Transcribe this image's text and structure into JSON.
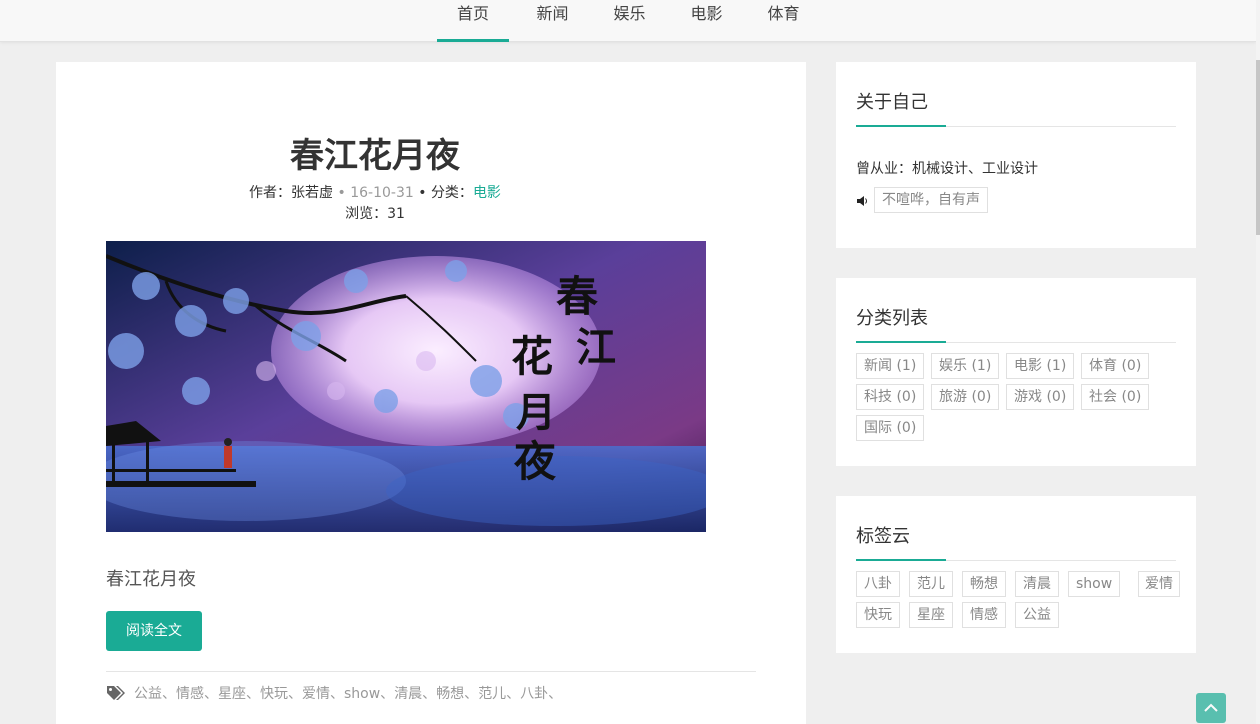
{
  "nav": {
    "items": [
      {
        "label": "首页",
        "active": true
      },
      {
        "label": "新闻",
        "active": false
      },
      {
        "label": "娱乐",
        "active": false
      },
      {
        "label": "电影",
        "active": false
      },
      {
        "label": "体育",
        "active": false
      }
    ]
  },
  "post": {
    "title": "春江花月夜",
    "author_label": "作者：",
    "author": "张若虚",
    "date": "16-10-31",
    "category_label": "分类：",
    "category": "电影",
    "views_label": "浏览：",
    "views": "31",
    "excerpt": "春江花月夜",
    "read_more": "阅读全文",
    "banner_text": [
      "春",
      "江",
      "花",
      "月",
      "夜"
    ],
    "tags": [
      "公益、",
      "情感、",
      "星座、",
      "快玩、",
      "爱情、",
      "show、",
      "清晨、",
      "畅想、",
      "范儿、",
      "八卦、"
    ]
  },
  "about": {
    "title": "关于自己",
    "work": "曾从业：机械设计、工业设计",
    "motto": "不喧哗，自有声"
  },
  "categories": {
    "title": "分类列表",
    "items": [
      "新闻 (1)",
      "娱乐 (1)",
      "电影 (1)",
      "体育 (0)",
      "科技 (0)",
      "旅游 (0)",
      "游戏 (0)",
      "社会 (0)",
      "国际 (0)"
    ]
  },
  "tagcloud": {
    "title": "标签云",
    "items": [
      "八卦",
      "范儿",
      "畅想",
      "清晨",
      "show",
      "爱情",
      "快玩",
      "星座",
      "情感",
      "公益"
    ]
  },
  "colors": {
    "accent": "#1aab95",
    "page_bg": "#efefef"
  }
}
